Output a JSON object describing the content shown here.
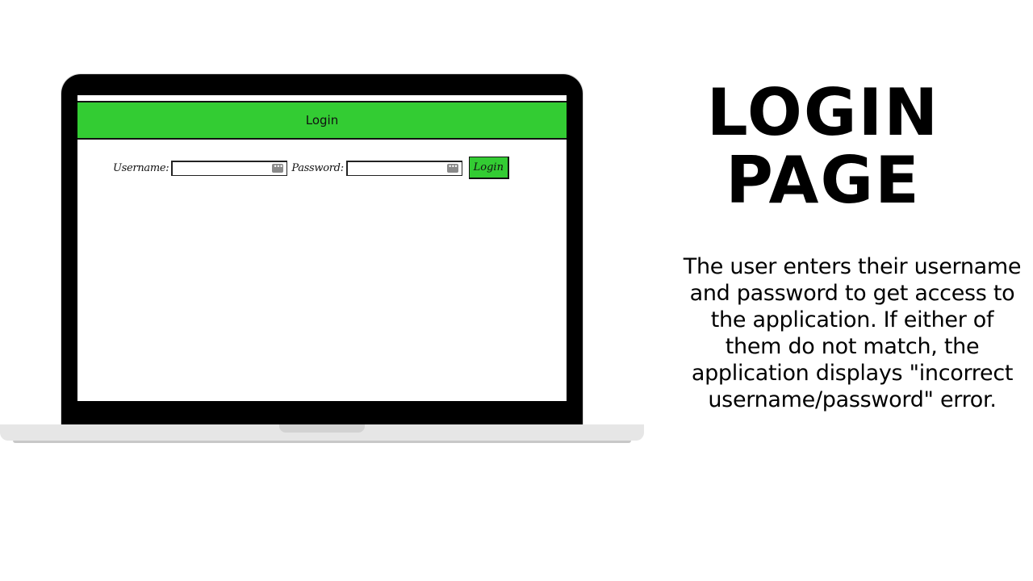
{
  "app": {
    "header_title": "Login",
    "form": {
      "username_label": "Username:",
      "username_value": "",
      "password_label": "Password:",
      "password_value": "",
      "login_button": "Login"
    }
  },
  "slide": {
    "title_line1": "LOGIN",
    "title_line2": "PAGE",
    "description": "The user enters their username and password to get access to the application. If either of them do not match, the application displays \"incorrect username/password\" error."
  },
  "colors": {
    "header_green": "#33cc33",
    "button_green": "#33cc33",
    "laptop_frame": "#000000",
    "laptop_base": "#e6e6e6"
  },
  "icons": {
    "field_icon": "key-autofill-icon"
  }
}
